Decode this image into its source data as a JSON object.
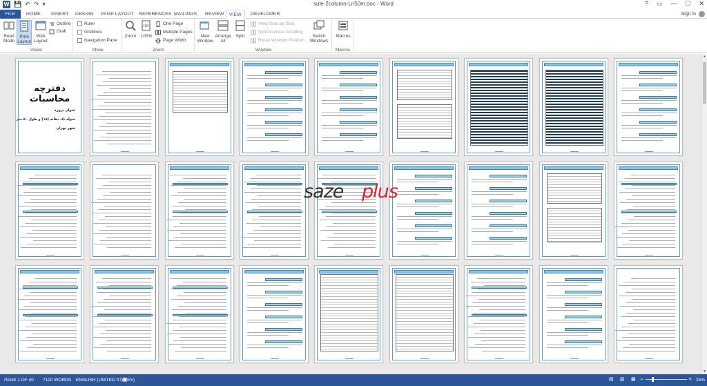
{
  "window": {
    "title": "sule-2column-Ln50m.doc - Word",
    "controls": [
      "?",
      "▭",
      "—",
      "☐",
      "✕"
    ]
  },
  "ribbon_tabs": [
    "FILE",
    "HOME",
    "INSERT",
    "DESIGN",
    "PAGE LAYOUT",
    "REFERENCES",
    "MAILINGS",
    "REVIEW",
    "VIEW",
    "DEVELOPER"
  ],
  "active_tab": "VIEW",
  "sign_in": "Sign in",
  "ribbon": {
    "views": {
      "label": "Views",
      "read_mode": [
        "Read",
        "Mode"
      ],
      "print_layout": [
        "Print",
        "Layout"
      ],
      "web_layout": [
        "Web",
        "Layout"
      ],
      "outline": "Outline",
      "draft": "Draft"
    },
    "show": {
      "label": "Show",
      "ruler": "Ruler",
      "gridlines": "Gridlines",
      "navigation_pane": "Navigation Pane"
    },
    "zoom": {
      "label": "Zoom",
      "zoom": "Zoom",
      "hundred": "100%",
      "one_page": "One Page",
      "multiple_pages": "Multiple Pages",
      "page_width": "Page Width"
    },
    "window": {
      "label": "Window",
      "new_window": [
        "New",
        "Window"
      ],
      "arrange_all": [
        "Arrange",
        "All"
      ],
      "split": "Split",
      "view_side_by_side": "View Side by Side",
      "synchronous_scrolling": "Synchronous Scrolling",
      "reset_window_position": "Reset Window Position",
      "switch_windows": [
        "Switch",
        "Windows"
      ]
    },
    "macros": {
      "label": "Macros",
      "macros": "Macros"
    }
  },
  "cover": {
    "title": "دفترچه محاسبات",
    "line1": "عنوان پروژه",
    "line2": "سوله تک دهانه (۱۵) و طول ۵۰ متر",
    "line3": "شهر تهران"
  },
  "watermark": {
    "part1": "saze",
    "part2": "plus"
  },
  "status": {
    "page": "PAGE 1 OF 40",
    "words": "7120 WORDS",
    "language": "ENGLISH (UNITED STATES)",
    "zoom": "25%"
  },
  "colors": {
    "brand": "#2b579a",
    "page_header": "#8fc3dd",
    "page_frame": "#5b9bd5",
    "watermark_red": "#d9232e"
  }
}
